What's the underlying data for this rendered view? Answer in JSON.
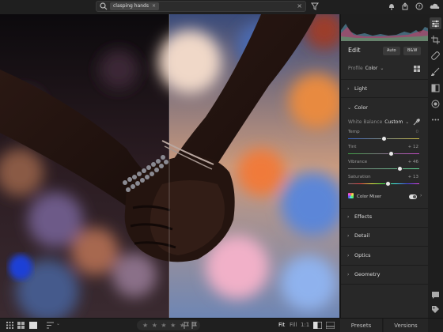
{
  "search": {
    "chip": "clasping hands",
    "chip_close": "×",
    "clear": "×"
  },
  "edit": {
    "title": "Edit",
    "auto_label": "Auto",
    "bw_label": "B&W",
    "profile_label": "Profile",
    "profile_value": "Color",
    "sections": {
      "light": "Light",
      "color": "Color",
      "effects": "Effects",
      "detail": "Detail",
      "optics": "Optics",
      "geometry": "Geometry"
    },
    "white_balance_label": "White Balance",
    "white_balance_value": "Custom",
    "sliders": [
      {
        "label": "Temp",
        "value": "0",
        "fraction": 0.5
      },
      {
        "label": "Tint",
        "value": "+ 12",
        "fraction": 0.6
      },
      {
        "label": "Vibrance",
        "value": "+ 46",
        "fraction": 0.73
      },
      {
        "label": "Saturation",
        "value": "+ 13",
        "fraction": 0.56
      }
    ],
    "color_mixer_label": "Color Mixer"
  },
  "bottom": {
    "stars": "★ ★ ★ ★ ★",
    "zoom_fit": "Fit",
    "zoom_fill": "Fill",
    "zoom_1to1": "1:1",
    "presets_tab": "Presets",
    "versions_tab": "Versions"
  },
  "icons": {
    "top": [
      "search-icon",
      "filter-icon",
      "bell-icon",
      "share-icon",
      "help-icon",
      "cloud-icon"
    ],
    "rail": [
      "edit-sliders-icon",
      "crop-icon",
      "healing-icon",
      "brush-icon",
      "gradient-icon",
      "radial-icon",
      "more-icon",
      "comment-icon",
      "tag-icon"
    ]
  },
  "colors": {
    "accent": "#1473e6",
    "panel": "#282828",
    "chrome": "#1f1f1f"
  }
}
